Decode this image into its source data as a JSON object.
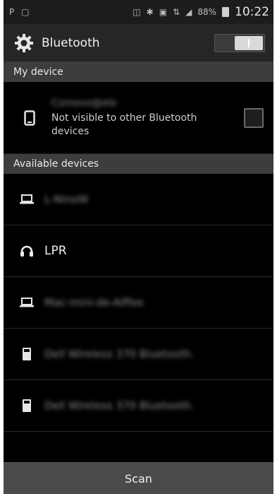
{
  "status_bar": {
    "left_icons": [
      "p-icon",
      "storage-icon"
    ],
    "right_icons": [
      "vibrate-icon",
      "bluetooth-icon",
      "nfc-icon",
      "data-icon",
      "signal-icon"
    ],
    "battery": "88%",
    "time": "10:22"
  },
  "action_bar": {
    "title": "Bluetooth",
    "toggle_on": true
  },
  "my_device": {
    "header": "My device",
    "name": "Comovo@elo",
    "status": "Not visible to other Bluetooth devices",
    "visible_checked": false
  },
  "available": {
    "header": "Available devices",
    "devices": [
      {
        "icon": "laptop-icon",
        "label": "L-NinoW",
        "blurred": true
      },
      {
        "icon": "headphones-icon",
        "label": "LPR",
        "blurred": false
      },
      {
        "icon": "laptop-icon",
        "label": "Mac-mini-de-Alffee",
        "blurred": true
      },
      {
        "icon": "phone-device-icon",
        "label": "Dell Wireless 370 Bluetooth.",
        "blurred": true
      },
      {
        "icon": "phone-device-icon",
        "label": "Dell Wireless 370 Bluetooth.",
        "blurred": true
      }
    ]
  },
  "scan_label": "Scan",
  "colors": {
    "background": "#000000",
    "action_bar": "#262626",
    "section_header": "#3d3d3d",
    "scan_bar": "#4a4a4a"
  }
}
